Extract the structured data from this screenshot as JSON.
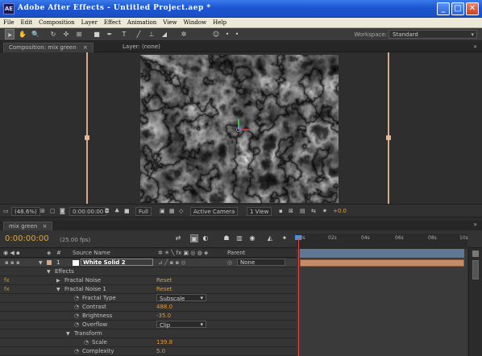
{
  "window": {
    "title": "Adobe After Effects - Untitled Project.aep *",
    "icon": "AE"
  },
  "window_buttons": {
    "minimize": "_",
    "maximize": "□",
    "close": "✕"
  },
  "menu": [
    "File",
    "Edit",
    "Composition",
    "Layer",
    "Effect",
    "Animation",
    "View",
    "Window",
    "Help"
  ],
  "toolbar": {
    "workspace_label": "Workspace:",
    "workspace_value": "Standard"
  },
  "comp_panel": {
    "tab_composition": "Composition: mix green",
    "tab_layer": "Layer: (none)"
  },
  "viewer_bar": {
    "zoom": "(48.6%)",
    "timecode": "0:00:00:00",
    "resolution": "Full",
    "camera": "Active Camera",
    "views": "1 View",
    "exposure": "+0.0"
  },
  "timeline": {
    "tab": "mix green",
    "timecode": "0:00:00:00",
    "fps": "(25.00 fps)",
    "ruler_labels": [
      "00s",
      "02s",
      "04s",
      "06s",
      "08s",
      "10s"
    ],
    "columns": {
      "num": "#",
      "source_name": "Source Name",
      "parent": "Parent"
    },
    "layer": {
      "number": "1",
      "name": "White Solid 2",
      "parent": "None"
    },
    "rows": [
      {
        "label": "Effects",
        "value": ""
      },
      {
        "label": "Fractal Noise",
        "value": "Reset"
      },
      {
        "label": "Fractal Noise 1",
        "value": "Reset"
      },
      {
        "label": "Fractal Type",
        "value": "Subscale"
      },
      {
        "label": "Contrast",
        "value": "488.0"
      },
      {
        "label": "Brightness",
        "value": "-35.0"
      },
      {
        "label": "Overflow",
        "value": "Clip"
      },
      {
        "label": "Transform",
        "value": ""
      },
      {
        "label": "Scale",
        "value": "139.8"
      },
      {
        "label": "Complexity",
        "value": "5.0"
      }
    ]
  },
  "colors": {
    "accent_orange": "#e0a73c",
    "layer_bar": "#c38d6a",
    "title_blue": "#1d56d1"
  }
}
